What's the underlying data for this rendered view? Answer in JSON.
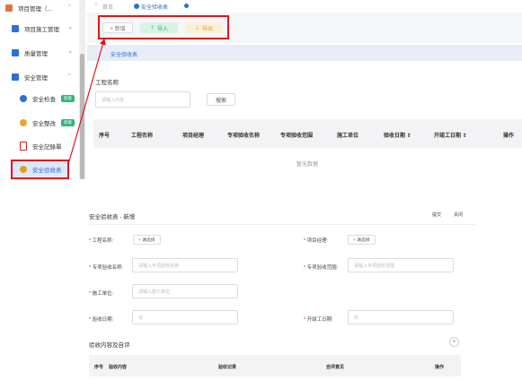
{
  "sidebar": {
    "items": [
      {
        "label": "项目管理（...",
        "icon": "folder-icon",
        "chevron": "^"
      },
      {
        "label": "项目施工管理",
        "icon": "folder-icon",
        "chevron": "∨"
      },
      {
        "label": "质量管理",
        "icon": "folder-icon",
        "chevron": "∨"
      },
      {
        "label": "安全管理",
        "icon": "folder-icon",
        "chevron": "^"
      }
    ],
    "subitems": [
      {
        "label": "安全检查",
        "icon": "user-shield-icon",
        "badge": "新版"
      },
      {
        "label": "安全整改",
        "icon": "edit-icon",
        "badge": "新版"
      },
      {
        "label": "安全記錄單",
        "icon": "document-icon",
        "badge": ""
      },
      {
        "label": "安全验收表",
        "icon": "user-check-icon",
        "badge": ""
      }
    ]
  },
  "tabs": {
    "home": "首页",
    "active": "安全验收表"
  },
  "toolbar": {
    "add": "+ 新增",
    "import": "导入",
    "export": "导出"
  },
  "subtab": "安全验收表",
  "search": {
    "label": "工程名称",
    "placeholder": "请输入内容",
    "button": "搜索"
  },
  "table": {
    "columns": [
      "序号",
      "工程名称",
      "项目经理",
      "专项验收名称",
      "专项验收范围",
      "施工单位",
      "验收日期 ⇕",
      "开竣工日期 ⇕",
      "操作"
    ],
    "empty": "暂无数据"
  },
  "form": {
    "title": "安全验收表 - 新增",
    "submit": "提交",
    "close": "关闭",
    "fields": {
      "project_name": "工程名称:",
      "project_manager": "项目经理:",
      "special_name": "专项验收名称:",
      "special_scope": "专项验收范围:",
      "contractor": "施工单位:",
      "accept_date": "验收日期:",
      "start_date": "开竣工日期:"
    },
    "select_label": "+ 请选择",
    "placeholders": {
      "special_name": "请输入专项验收名称",
      "special_scope": "请输入专项验收范围",
      "contractor": "请输入施工单位",
      "date": "日"
    },
    "section": "验收内容及自评",
    "add_icon": "+",
    "sub_columns": [
      "序号",
      "验收内容",
      "验收记录",
      "自评意见",
      "操作"
    ]
  }
}
